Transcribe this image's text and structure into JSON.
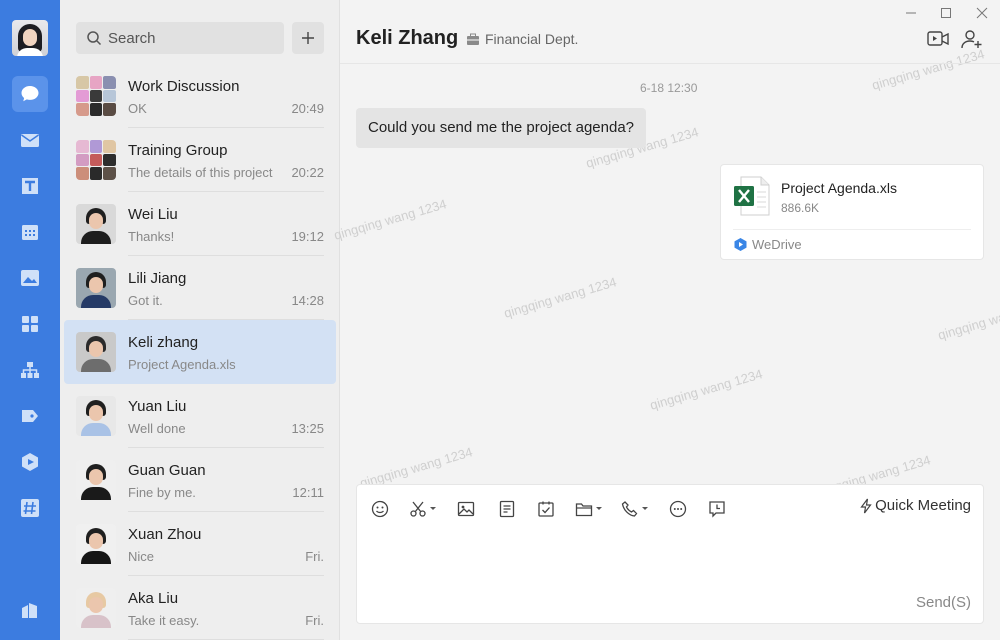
{
  "sidebar": {
    "avatar": "user-avatar",
    "items": [
      {
        "icon": "chat-icon",
        "active": true
      },
      {
        "icon": "mail-icon",
        "active": false
      },
      {
        "icon": "docs-icon",
        "active": false
      },
      {
        "icon": "calendar-icon",
        "active": false
      },
      {
        "icon": "photo-icon",
        "active": false
      },
      {
        "icon": "apps-icon",
        "active": false
      },
      {
        "icon": "org-chart-icon",
        "active": false
      },
      {
        "icon": "tag-icon",
        "active": false
      },
      {
        "icon": "wedrive-icon",
        "active": false
      },
      {
        "icon": "hashtag-icon",
        "active": false
      }
    ],
    "bottom": {
      "icon": "workspace-icon"
    }
  },
  "search": {
    "placeholder": "Search"
  },
  "conversations": [
    {
      "name": "Work Discussion",
      "preview": "OK",
      "time": "20:49",
      "avatar": "group"
    },
    {
      "name": "Training Group",
      "preview": "The details of this project",
      "time": "20:22",
      "avatar": "group"
    },
    {
      "name": "Wei Liu",
      "preview": "Thanks!",
      "time": "19:12",
      "avatar": "person"
    },
    {
      "name": "Lili Jiang",
      "preview": "Got it.",
      "time": "14:28",
      "avatar": "person"
    },
    {
      "name": "Keli zhang",
      "preview": "Project Agenda.xls",
      "time": "",
      "avatar": "person",
      "selected": true
    },
    {
      "name": "Yuan Liu",
      "preview": "Well done",
      "time": "13:25",
      "avatar": "person"
    },
    {
      "name": "Guan Guan",
      "preview": "Fine by me.",
      "time": "12:11",
      "avatar": "person"
    },
    {
      "name": "Xuan Zhou",
      "preview": "Nice",
      "time": "Fri.",
      "avatar": "person"
    },
    {
      "name": "Aka Liu",
      "preview": "Take it easy.",
      "time": "Fri.",
      "avatar": "person"
    }
  ],
  "chat": {
    "name": "Keli Zhang",
    "department": "Financial Dept.",
    "timestamp": "6-18 12:30",
    "incoming_message": "Could you send me the project agenda?",
    "file": {
      "name": "Project Agenda.xls",
      "size": "886.6K",
      "source": "WeDrive"
    },
    "watermark": "qingqing wang 1234"
  },
  "composer": {
    "quick_meeting": "Quick Meeting",
    "send": "Send(S)"
  },
  "colors": {
    "accent": "#3c7ce0",
    "selected_row": "#d3e1f4",
    "excel_green": "#1f7244"
  }
}
